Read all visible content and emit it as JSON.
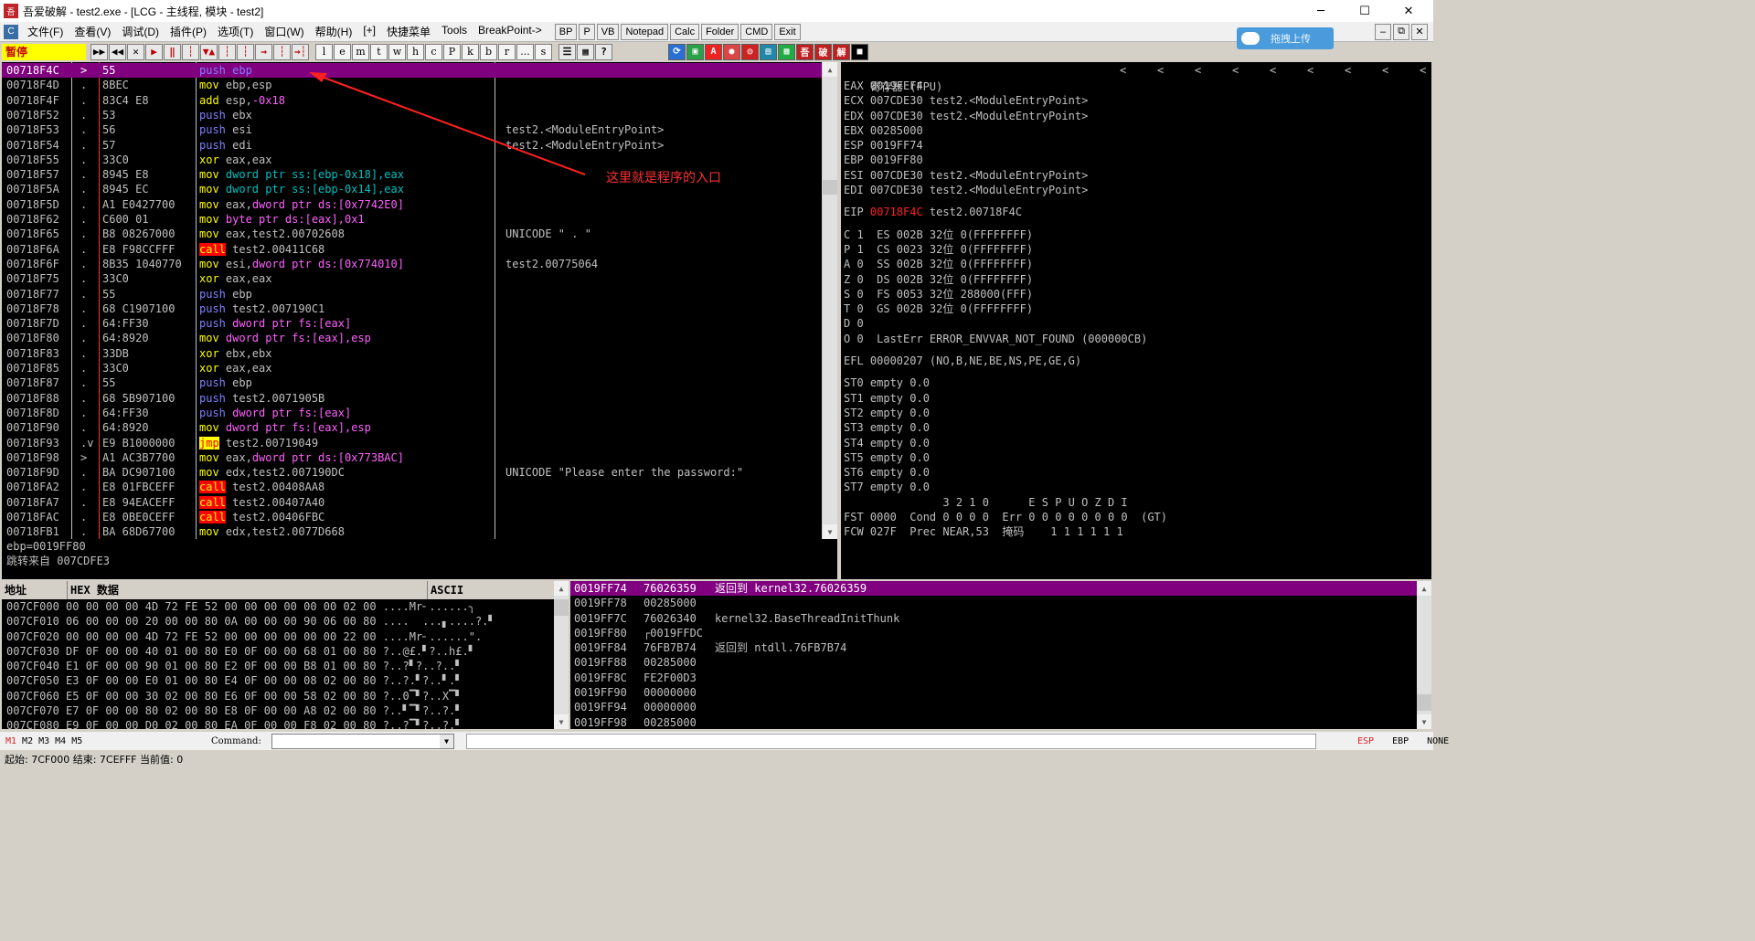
{
  "window": {
    "title": "吾爱破解 - test2.exe - [LCG - 主线程, 模块 - test2]",
    "app_icon": "吾",
    "controls": {
      "minimize": "─",
      "maximize": "☐",
      "close": "✕"
    }
  },
  "menu": {
    "items": [
      "文件(F)",
      "查看(V)",
      "调试(D)",
      "插件(P)",
      "选项(T)",
      "窗口(W)",
      "帮助(H)",
      "[+]",
      "快捷菜单",
      "Tools",
      "BreakPoint->"
    ],
    "buttons": [
      "BP",
      "P",
      "VB",
      "Notepad",
      "Calc",
      "Folder",
      "CMD",
      "Exit"
    ],
    "mdi": [
      "–",
      "⧉",
      "✕"
    ]
  },
  "toolbar": {
    "status": "暂停",
    "tools": [
      "▶▶",
      "◀◀",
      "✕",
      "▶",
      "‖",
      "┆",
      "▼▲",
      "┆",
      "┆",
      "→",
      "┆",
      "→┆"
    ],
    "letters": [
      "l",
      "e",
      "m",
      "t",
      "w",
      "h",
      "c",
      "P",
      "k",
      "b",
      "r",
      "...",
      "s"
    ],
    "extra": [
      "☰",
      "▦",
      "?"
    ],
    "plugin_labels": [
      "⟳",
      "▣",
      "A",
      "●",
      "◎",
      "▤",
      "▦",
      "吾",
      "破",
      "解",
      "■"
    ]
  },
  "upload": {
    "label": "拖拽上传"
  },
  "cpu": {
    "rows": [
      {
        "addr": "00718F4C",
        "mark": ">",
        "hex": "55",
        "ins": [
          [
            "push",
            "kwp"
          ],
          [
            " ebp",
            ""
          ]
        ],
        "cmt": "",
        "selected": true
      },
      {
        "addr": "00718F4D",
        "mark": ".",
        "hex": "8BEC",
        "ins": [
          [
            "mov",
            "kwm"
          ],
          [
            " ebp,esp",
            ""
          ]
        ],
        "cmt": ""
      },
      {
        "addr": "00718F4F",
        "mark": ".",
        "hex": "83C4 E8",
        "ins": [
          [
            "add",
            "kwm"
          ],
          [
            " esp,",
            ""
          ],
          [
            "-0x18",
            "imm"
          ]
        ],
        "cmt": ""
      },
      {
        "addr": "00718F52",
        "mark": ".",
        "hex": "53",
        "ins": [
          [
            "push",
            "kwp"
          ],
          [
            " ebx",
            ""
          ]
        ],
        "cmt": ""
      },
      {
        "addr": "00718F53",
        "mark": ".",
        "hex": "56",
        "ins": [
          [
            "push",
            "kwp"
          ],
          [
            " esi",
            ""
          ]
        ],
        "cmt": "test2.<ModuleEntryPoint>"
      },
      {
        "addr": "00718F54",
        "mark": ".",
        "hex": "57",
        "ins": [
          [
            "push",
            "kwp"
          ],
          [
            " edi",
            ""
          ]
        ],
        "cmt": "test2.<ModuleEntryPoint>"
      },
      {
        "addr": "00718F55",
        "mark": ".",
        "hex": "33C0",
        "ins": [
          [
            "xor",
            "kwm"
          ],
          [
            " eax,eax",
            ""
          ]
        ],
        "cmt": ""
      },
      {
        "addr": "00718F57",
        "mark": ".",
        "hex": "8945 E8",
        "ins": [
          [
            "mov",
            "kwm"
          ],
          [
            " dword ptr ss:[ebp-0x18],eax",
            "kw"
          ]
        ],
        "cmt": ""
      },
      {
        "addr": "00718F5A",
        "mark": ".",
        "hex": "8945 EC",
        "ins": [
          [
            "mov",
            "kwm"
          ],
          [
            " dword ptr ss:[ebp-0x14],eax",
            "kw"
          ]
        ],
        "cmt": ""
      },
      {
        "addr": "00718F5D",
        "mark": ".",
        "hex": "A1 E0427700",
        "ins": [
          [
            "mov",
            "kwm"
          ],
          [
            " eax,",
            ""
          ],
          [
            "dword ptr ds:[0x7742E0]",
            "imm"
          ]
        ],
        "cmt": ""
      },
      {
        "addr": "00718F62",
        "mark": ".",
        "hex": "C600 01",
        "ins": [
          [
            "mov",
            "kwm"
          ],
          [
            " byte ptr ds:[eax],",
            "imm"
          ],
          [
            "0x1",
            "imm"
          ]
        ],
        "cmt": ""
      },
      {
        "addr": "00718F65",
        "mark": ".",
        "hex": "B8 08267000",
        "ins": [
          [
            "mov",
            "kwm"
          ],
          [
            " eax,test2.00702608",
            ""
          ]
        ],
        "cmt": "UNICODE \" . \""
      },
      {
        "addr": "00718F6A",
        "mark": ".",
        "hex": "E8 F98CCFFF",
        "ins": [
          [
            "call",
            "kwc"
          ],
          [
            " test2.00411C68",
            ""
          ]
        ],
        "cmt": ""
      },
      {
        "addr": "00718F6F",
        "mark": ".",
        "hex": "8B35 1040770",
        "ins": [
          [
            "mov",
            "kwm"
          ],
          [
            " esi,",
            ""
          ],
          [
            "dword ptr ds:[0x774010]",
            "imm"
          ]
        ],
        "cmt": "test2.00775064"
      },
      {
        "addr": "00718F75",
        "mark": ".",
        "hex": "33C0",
        "ins": [
          [
            "xor",
            "kwm"
          ],
          [
            " eax,eax",
            ""
          ]
        ],
        "cmt": ""
      },
      {
        "addr": "00718F77",
        "mark": ".",
        "hex": "55",
        "ins": [
          [
            "push",
            "kwp"
          ],
          [
            " ebp",
            ""
          ]
        ],
        "cmt": ""
      },
      {
        "addr": "00718F78",
        "mark": ".",
        "hex": "68 C1907100",
        "ins": [
          [
            "push",
            "kwp"
          ],
          [
            " test2.007190C1",
            ""
          ]
        ],
        "cmt": ""
      },
      {
        "addr": "00718F7D",
        "mark": ".",
        "hex": "64:FF30",
        "ins": [
          [
            "push",
            "kwp"
          ],
          [
            " dword ptr fs:[eax]",
            "imm"
          ]
        ],
        "cmt": ""
      },
      {
        "addr": "00718F80",
        "mark": ".",
        "hex": "64:8920",
        "ins": [
          [
            "mov",
            "kwm"
          ],
          [
            " dword ptr fs:[eax],esp",
            "imm"
          ]
        ],
        "cmt": ""
      },
      {
        "addr": "00718F83",
        "mark": ".",
        "hex": "33DB",
        "ins": [
          [
            "xor",
            "kwm"
          ],
          [
            " ebx,ebx",
            ""
          ]
        ],
        "cmt": ""
      },
      {
        "addr": "00718F85",
        "mark": ".",
        "hex": "33C0",
        "ins": [
          [
            "xor",
            "kwm"
          ],
          [
            " eax,eax",
            ""
          ]
        ],
        "cmt": ""
      },
      {
        "addr": "00718F87",
        "mark": ".",
        "hex": "55",
        "ins": [
          [
            "push",
            "kwp"
          ],
          [
            " ebp",
            ""
          ]
        ],
        "cmt": ""
      },
      {
        "addr": "00718F88",
        "mark": ".",
        "hex": "68 5B907100",
        "ins": [
          [
            "push",
            "kwp"
          ],
          [
            " test2.0071905B",
            ""
          ]
        ],
        "cmt": ""
      },
      {
        "addr": "00718F8D",
        "mark": ".",
        "hex": "64:FF30",
        "ins": [
          [
            "push",
            "kwp"
          ],
          [
            " dword ptr fs:[eax]",
            "imm"
          ]
        ],
        "cmt": ""
      },
      {
        "addr": "00718F90",
        "mark": ".",
        "hex": "64:8920",
        "ins": [
          [
            "mov",
            "kwm"
          ],
          [
            " dword ptr fs:[eax],esp",
            "imm"
          ]
        ],
        "cmt": ""
      },
      {
        "addr": "00718F93",
        "mark": ".v",
        "hex": "E9 B1000000",
        "ins": [
          [
            "jmp",
            "kwj"
          ],
          [
            " test2.00719049",
            ""
          ]
        ],
        "cmt": ""
      },
      {
        "addr": "00718F98",
        "mark": ">",
        "hex": "A1 AC3B7700",
        "ins": [
          [
            "mov",
            "kwm"
          ],
          [
            " eax,",
            ""
          ],
          [
            "dword ptr ds:[0x773BAC]",
            "imm"
          ]
        ],
        "cmt": ""
      },
      {
        "addr": "00718F9D",
        "mark": ".",
        "hex": "BA DC907100",
        "ins": [
          [
            "mov",
            "kwm"
          ],
          [
            " edx,test2.007190DC",
            ""
          ]
        ],
        "cmt": "UNICODE \"Please enter the password:\""
      },
      {
        "addr": "00718FA2",
        "mark": ".",
        "hex": "E8 01FBCEFF",
        "ins": [
          [
            "call",
            "kwc"
          ],
          [
            " test2.00408AA8",
            ""
          ]
        ],
        "cmt": ""
      },
      {
        "addr": "00718FA7",
        "mark": ".",
        "hex": "E8 94EACEFF",
        "ins": [
          [
            "call",
            "kwc"
          ],
          [
            " test2.00407A40",
            ""
          ]
        ],
        "cmt": ""
      },
      {
        "addr": "00718FAC",
        "mark": ".",
        "hex": "E8 0BE0CEFF",
        "ins": [
          [
            "call",
            "kwc"
          ],
          [
            " test2.00406FBC",
            ""
          ]
        ],
        "cmt": ""
      },
      {
        "addr": "00718FB1",
        "mark": ".",
        "hex": "BA 68D67700",
        "ins": [
          [
            "mov",
            "kwm"
          ],
          [
            " edx,test2.0077D668",
            ""
          ]
        ],
        "cmt": ""
      }
    ],
    "annotation": "这里就是程序的入口"
  },
  "info": {
    "line1": "ebp=0019FF80",
    "line2": "跳转来自 007CDFE3"
  },
  "registers": {
    "header": "寄存器 (FPU)",
    "lines": [
      "EAX 0019FEF4",
      "ECX 007CDE30 test2.<ModuleEntryPoint>",
      "EDX 007CDE30 test2.<ModuleEntryPoint>",
      "EBX 00285000",
      "ESP 0019FF74",
      "EBP 0019FF80",
      "ESI 007CDE30 test2.<ModuleEntryPoint>",
      "EDI 007CDE30 test2.<ModuleEntryPoint>",
      "",
      "EIP |00718F4C| test2.00718F4C",
      "",
      "C 1  ES 002B 32位 0(FFFFFFFF)",
      "P 1  CS 0023 32位 0(FFFFFFFF)",
      "A 0  SS 002B 32位 0(FFFFFFFF)",
      "Z 0  DS 002B 32位 0(FFFFFFFF)",
      "S 0  FS 0053 32位 288000(FFF)",
      "T 0  GS 002B 32位 0(FFFFFFFF)",
      "D 0",
      "O 0  LastErr ERROR_ENVVAR_NOT_FOUND (000000CB)",
      "",
      "EFL 00000207 (NO,B,NE,BE,NS,PE,GE,G)",
      "",
      "ST0 empty 0.0",
      "ST1 empty 0.0",
      "ST2 empty 0.0",
      "ST3 empty 0.0",
      "ST4 empty 0.0",
      "ST5 empty 0.0",
      "ST6 empty 0.0",
      "ST7 empty 0.0",
      "               3 2 1 0      E S P U O Z D I",
      "FST 0000  Cond 0 0 0 0  Err 0 0 0 0 0 0 0 0  (GT)",
      "FCW 027F  Prec NEAR,53  掩码    1 1 1 1 1 1"
    ]
  },
  "dump": {
    "headers": [
      "地址",
      "HEX 数据",
      "ASCII"
    ],
    "rows": [
      "007CF000 00 00 00 00 4D 72 FE 52 00 00 00 00 00 00 02 00 ....Mr╴......╮",
      "007CF010 06 00 00 00 20 00 00 80 0A 00 00 00 90 06 00 80 ....  ...▖....?.▘",
      "007CF020 00 00 00 00 4D 72 FE 52 00 00 00 00 00 00 22 00 ....Mr╴......\".",
      "007CF030 DF 0F 00 00 40 01 00 80 E0 0F 00 00 68 01 00 80 ?..@£.▘?..h£.▘",
      "007CF040 E1 0F 00 00 90 01 00 80 E2 0F 00 00 B8 01 00 80 ?..?▘?..?..▘",
      "007CF050 E3 0F 00 00 E0 01 00 80 E4 0F 00 00 08 02 00 80 ?..?.▘?..▘.▘",
      "007CF060 E5 0F 00 00 30 02 00 80 E6 0F 00 00 58 02 00 80 ?..0▔▘?..X▔▘",
      "007CF070 E7 0F 00 00 80 02 00 80 E8 0F 00 00 A8 02 00 80 ?..▘▔▘?..?.▘",
      "007CF080 E9 0F 00 00 D0 02 00 80 EA 0F 00 00 F8 02 00 80 ?..?▔▘?..?.▘"
    ]
  },
  "stack": {
    "rows": [
      {
        "addr": "0019FF74",
        "val": "76026359",
        "cmt": "返回到 kernel32.76026359",
        "sel": true
      },
      {
        "addr": "0019FF78",
        "val": "00285000",
        "cmt": ""
      },
      {
        "addr": "0019FF7C",
        "val": "76026340",
        "cmt": "kernel32.BaseThreadInitThunk"
      },
      {
        "addr": "0019FF80",
        "val": "┌0019FFDC",
        "cmt": ""
      },
      {
        "addr": "0019FF84",
        "val": "76FB7B74",
        "cmt": "返回到 ntdll.76FB7B74"
      },
      {
        "addr": "0019FF88",
        "val": "00285000",
        "cmt": ""
      },
      {
        "addr": "0019FF8C",
        "val": "FE2F00D3",
        "cmt": ""
      },
      {
        "addr": "0019FF90",
        "val": "00000000",
        "cmt": ""
      },
      {
        "addr": "0019FF94",
        "val": "00000000",
        "cmt": ""
      },
      {
        "addr": "0019FF98",
        "val": "00285000",
        "cmt": ""
      }
    ]
  },
  "cmd": {
    "tabs": [
      "M1",
      "M2",
      "M3",
      "M4",
      "M5"
    ],
    "label": "Command:",
    "right": [
      "ESP",
      "EBP",
      "NONE"
    ]
  },
  "status": {
    "text": "起始: 7CF000 结束: 7CEFFF 当前值: 0"
  },
  "colors": {
    "selected_row": "#800080",
    "annotation": "#ff3030",
    "pause_bg": "#ffff00"
  }
}
